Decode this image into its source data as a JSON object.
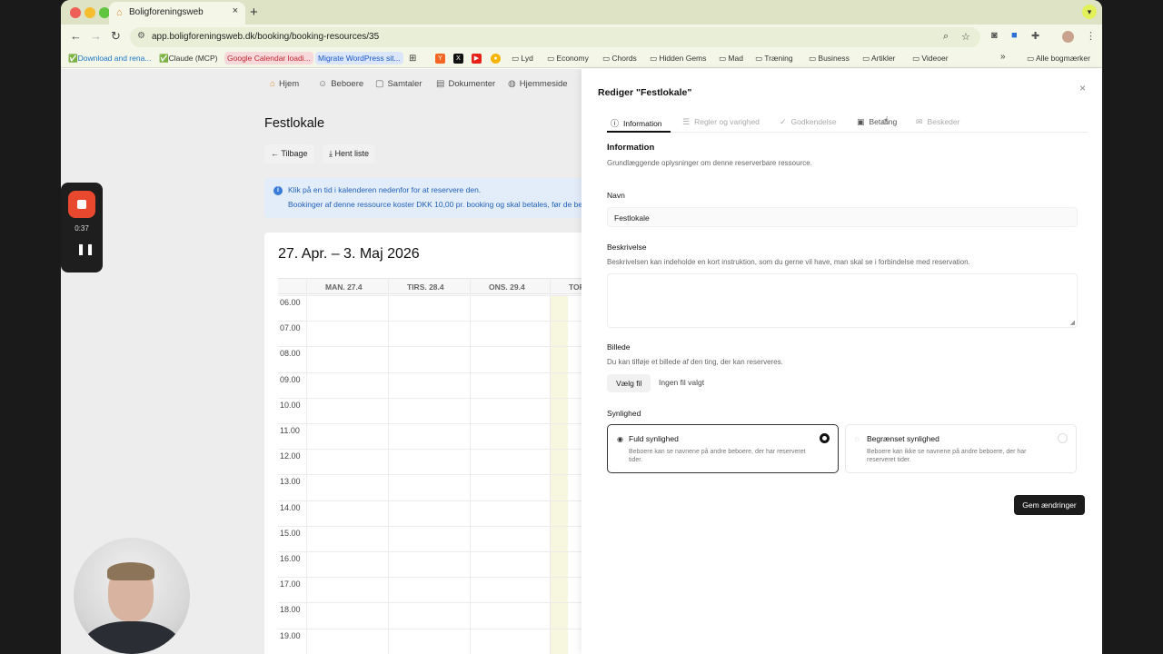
{
  "browser": {
    "tab_title": "Boligforeningsweb",
    "url": "app.boligforeningsweb.dk/booking/booking-resources/35",
    "bookmarks": [
      "Download and rena...",
      "Claude (MCP)",
      "Google Calendar loadi...",
      "Migrate WordPress sit...",
      "Lyd",
      "Economy",
      "Chords",
      "Hidden Gems",
      "Mad",
      "Træning",
      "Business",
      "Artikler",
      "Videoer"
    ],
    "all_bookmarks": "Alle bogmærker"
  },
  "nav": {
    "items": [
      "Hjem",
      "Beboere",
      "Samtaler",
      "Dokumenter",
      "Hjemmeside"
    ]
  },
  "page": {
    "title": "Festlokale",
    "back_button": "Tilbage",
    "download_button": "Hent liste",
    "info_line1": "Klik på en tid i kalenderen nedenfor for at reservere den.",
    "info_line2": "Bookinger af denne ressource koster DKK 10,00 pr. booking og skal betales, før de be"
  },
  "calendar": {
    "range": "27. Apr. – 3. Maj 2026",
    "days": [
      "MAN. 27.4",
      "TIRS. 28.4",
      "ONS. 29.4",
      "TOR"
    ],
    "hours": [
      "06.00",
      "07.00",
      "08.00",
      "09.00",
      "10.00",
      "11.00",
      "12.00",
      "13.00",
      "14.00",
      "15.00",
      "16.00",
      "17.00",
      "18.00",
      "19.00"
    ]
  },
  "recorder": {
    "time": "0:37"
  },
  "panel": {
    "title": "Rediger \"Festlokale\"",
    "tabs": [
      "Information",
      "Regler og varighed",
      "Godkendelse",
      "Betaling",
      "Beskeder"
    ],
    "section_title": "Information",
    "section_desc": "Grundlæggende oplysninger om denne reserverbare ressource.",
    "name_label": "Navn",
    "name_value": "Festlokale",
    "desc_label": "Beskrivelse",
    "desc_help": "Beskrivelsen kan indeholde en kort instruktion, som du gerne vil have, man skal se i forbindelse med reservation.",
    "image_label": "Billede",
    "image_help": "Du kan tilføje et billede af den ting, der kan reserveres.",
    "file_button": "Vælg fil",
    "file_status": "Ingen fil valgt",
    "visibility_label": "Synlighed",
    "visibility_full_title": "Fuld synlighed",
    "visibility_full_desc": "Beboere kan se navnene på andre beboere, der har reserveret tider.",
    "visibility_limited_title": "Begrænset synlighed",
    "visibility_limited_desc": "Beboere kan ikke se navnene på andre beboere, der har reserveret tider.",
    "save_button": "Gem ændringer"
  }
}
